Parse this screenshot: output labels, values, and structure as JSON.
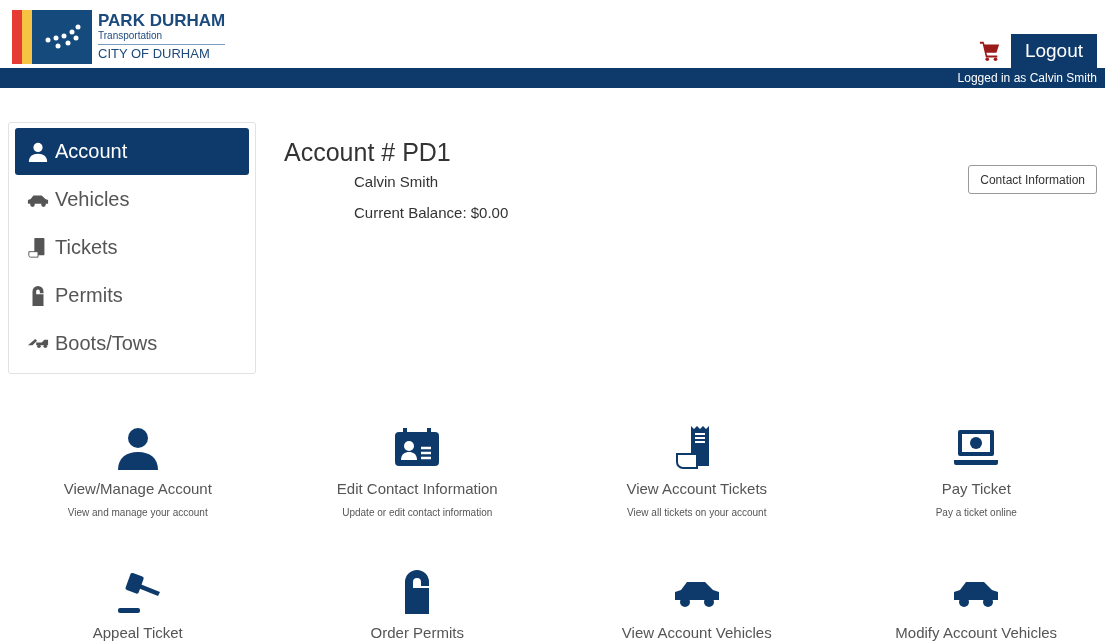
{
  "logo": {
    "title": "PARK DURHAM",
    "subtitle": "Transportation",
    "city": "CITY OF DURHAM"
  },
  "header": {
    "logout": "Logout",
    "logged_in": "Logged in as Calvin Smith"
  },
  "sidebar": {
    "items": [
      {
        "label": "Account",
        "kind": "person",
        "selected": true
      },
      {
        "label": "Vehicles",
        "kind": "car",
        "selected": false
      },
      {
        "label": "Tickets",
        "kind": "ticket",
        "selected": false
      },
      {
        "label": "Permits",
        "kind": "hanger",
        "selected": false
      },
      {
        "label": "Boots/Tows",
        "kind": "tow",
        "selected": false
      }
    ]
  },
  "account": {
    "title": "Account # PD1",
    "name": "Calvin Smith",
    "balance": "Current Balance: $0.00",
    "contact_button": "Contact Information"
  },
  "tiles": [
    {
      "kind": "person",
      "title": "View/Manage Account",
      "description": "View and manage your account"
    },
    {
      "kind": "idcard",
      "title": "Edit Contact Information",
      "description": "Update or edit contact information"
    },
    {
      "kind": "receipt",
      "title": "View Account Tickets",
      "description": "View all tickets on your account"
    },
    {
      "kind": "laptop",
      "title": "Pay Ticket",
      "description": "Pay a ticket online"
    },
    {
      "kind": "gavel",
      "title": "Appeal Ticket"
    },
    {
      "kind": "hanger",
      "title": "Order Permits"
    },
    {
      "kind": "car",
      "title": "View Account Vehicles"
    },
    {
      "kind": "car",
      "title": "Modify Account Vehicles"
    }
  ]
}
